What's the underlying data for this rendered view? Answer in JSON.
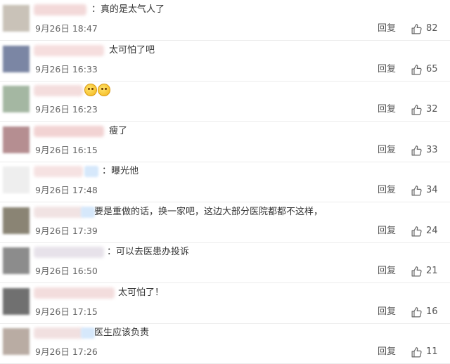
{
  "comments": [
    {
      "text": "：真的是太气人了",
      "time": "9月26日 18:47",
      "reply": "回复",
      "likes": "82",
      "avatar_color": "#c9c2b8",
      "name_color": "#f3d9d9"
    },
    {
      "text": "太可怕了吧",
      "time": "9月26日 16:33",
      "reply": "回复",
      "likes": "65",
      "avatar_color": "#7b86a4",
      "name_color": "#f6dede"
    },
    {
      "text": "",
      "emoji_count": 2,
      "time": "9月26日 16:23",
      "reply": "回复",
      "likes": "32",
      "avatar_color": "#a4b7a2",
      "name_color": "#f4dddd"
    },
    {
      "text": "瘦了",
      "time": "9月26日 16:15",
      "reply": "回复",
      "likes": "33",
      "avatar_color": "#b58e91",
      "name_color": "#f2d3d3"
    },
    {
      "text": "：曝光他",
      "time": "9月26日 17:48",
      "reply": "回复",
      "likes": "34",
      "avatar_color": "#eeeeee",
      "name_color": "#f6e2e2"
    },
    {
      "text": "要是重做的话，换一家吧，这边大部分医院都都不这样，",
      "time": "9月26日 17:39",
      "reply": "回复",
      "likes": "24",
      "avatar_color": "#8a8474",
      "name_color": "#f1e3e3"
    },
    {
      "text": "：可以去医患办投诉",
      "time": "9月26日 16:50",
      "reply": "回复",
      "likes": "21",
      "avatar_color": "#8c8c8c",
      "name_color": "#e7e2ea"
    },
    {
      "text": "太可怕了！",
      "time": "9月26日 17:15",
      "reply": "回复",
      "likes": "16",
      "avatar_color": "#707070",
      "name_color": "#f3dddd"
    },
    {
      "text": "医生应该负责",
      "time": "9月26日 17:26",
      "reply": "回复",
      "likes": "11",
      "avatar_color": "#b9aca3",
      "name_color": "#f1e0e0"
    }
  ]
}
